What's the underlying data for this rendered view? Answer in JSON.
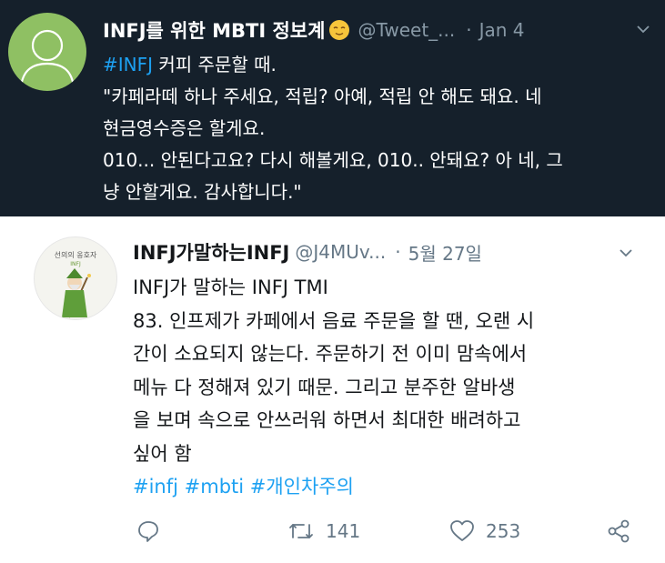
{
  "tweet1": {
    "display_name": "INFJ를 위한 MBTI 정보계",
    "handle": "@Tweet_...",
    "separator": "·",
    "date": "Jan 4",
    "hashtag": "#INFJ",
    "line1_rest": " 커피 주문할 때.",
    "lines": [
      "\"카페라떼 하나 주세요, 적립? 아예, 적립 안 해도 돼요. 네",
      "현금영수증은 할게요.",
      "010... 안된다고요? 다시 해볼게요, 010.. 안돼요? 아 네, 그",
      "냥 안할게요. 감사합니다.\""
    ],
    "icons": {
      "avatar": "default-avatar-icon",
      "emoji": "relieved-face-emoji-icon",
      "menu": "chevron-down-icon"
    },
    "colors": {
      "background": "#15202b",
      "avatar": "#8fc063",
      "link": "#1da1f2",
      "muted": "#8899a6"
    }
  },
  "tweet2": {
    "display_name": "INFJ가말하는INFJ",
    "handle": "@J4MUv...",
    "separator": "·",
    "date": "5월 27일",
    "avatar_caption": "선의의 옹호자",
    "avatar_sub": "INFJ",
    "lines": [
      "INFJ가 말하는 INFJ TMI",
      "83. 인프제가 카페에서 음료 주문을 할 땐, 오랜 시",
      "간이 소요되지 않는다. 주문하기 전 이미 맘속에서",
      "메뉴 다 정해져 있기 때문. 그리고 분주한 알바생",
      "을 보며 속으로 안쓰러워 하면서 최대한 배려하고",
      "싶어 함"
    ],
    "hashtags": "#infj #mbti #개인차주의",
    "actions": {
      "retweet_count": "141",
      "like_count": "253"
    },
    "icons": {
      "avatar": "advocate-character-avatar-icon",
      "menu": "chevron-down-icon",
      "reply": "reply-icon",
      "retweet": "retweet-icon",
      "like": "heart-icon",
      "share": "share-icon"
    },
    "colors": {
      "text": "#14171a",
      "link": "#1da1f2",
      "muted": "#657786"
    }
  }
}
